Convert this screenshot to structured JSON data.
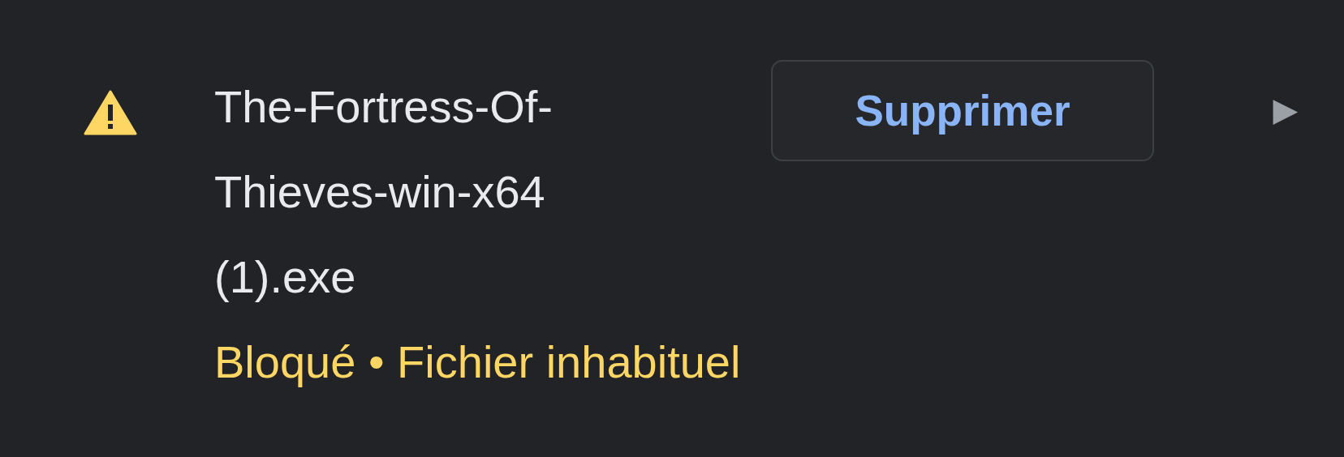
{
  "download": {
    "filename": "The-Fortress-Of-Thieves-win-x64 (1).exe",
    "status": "Bloqué • Fichier inhabituel",
    "button": "Supprimer",
    "expand": "▶"
  }
}
